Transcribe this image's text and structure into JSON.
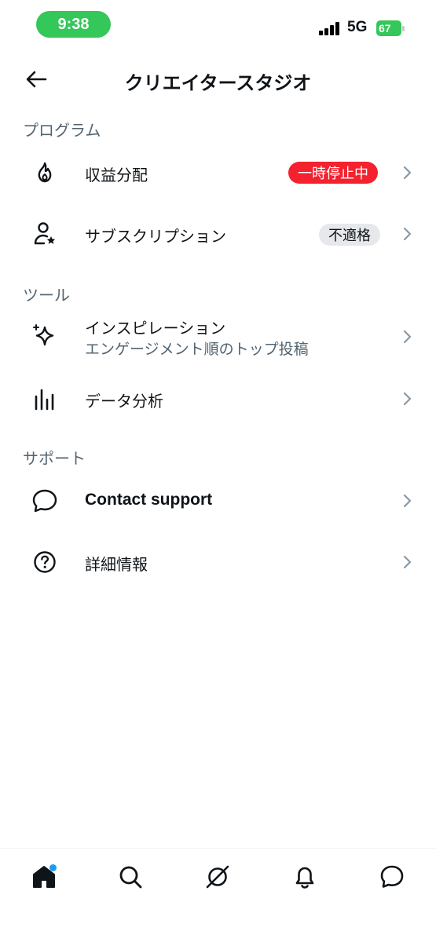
{
  "status_bar": {
    "time": "9:38",
    "network": "5G",
    "battery": "67"
  },
  "header": {
    "title": "クリエイタースタジオ"
  },
  "sections": [
    {
      "title": "プログラム"
    },
    {
      "title": "ツール"
    },
    {
      "title": "サポート"
    }
  ],
  "items": {
    "revenue": {
      "label": "収益分配",
      "badge": "一時停止中",
      "icon": "flame-icon"
    },
    "subscriptions": {
      "label": "サブスクリプション",
      "badge": "不適格",
      "icon": "person-star-icon"
    },
    "inspiration": {
      "label": "インスピレーション",
      "sublabel": "エンゲージメント順のトップ投稿",
      "icon": "sparkle-icon"
    },
    "analytics": {
      "label": "データ分析",
      "icon": "bar-chart-icon"
    },
    "contact": {
      "label": "Contact support",
      "icon": "chat-bubble-icon"
    },
    "more_info": {
      "label": "詳細情報",
      "icon": "question-circle-icon"
    }
  },
  "bottom_nav": [
    "home-icon",
    "search-icon",
    "grok-icon",
    "bell-icon",
    "messages-icon"
  ],
  "colors": {
    "accent": "#1d9bf0",
    "status_green": "#34c759",
    "badge_red": "#f4212e",
    "muted_text": "#536471"
  }
}
